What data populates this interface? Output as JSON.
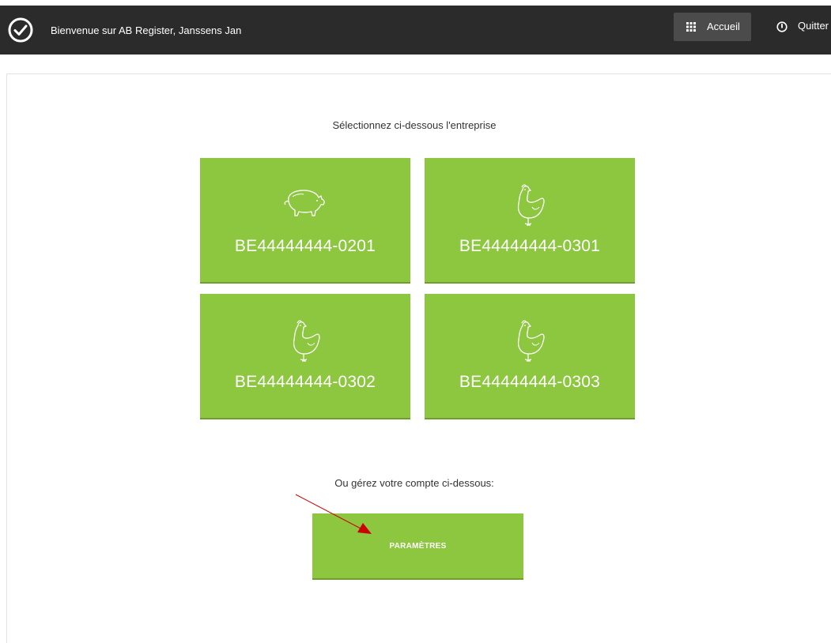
{
  "header": {
    "welcome": "Bienvenue sur AB Register, Janssens Jan",
    "home_label": "Accueil",
    "quit_label": "Quitter"
  },
  "main": {
    "heading": "Sélectionnez ci-dessous l'entreprise",
    "tiles": [
      {
        "code": "BE44444444-0201",
        "icon": "pig-icon"
      },
      {
        "code": "BE44444444-0301",
        "icon": "chicken-icon"
      },
      {
        "code": "BE44444444-0302",
        "icon": "chicken-icon"
      },
      {
        "code": "BE44444444-0303",
        "icon": "chicken-icon"
      }
    ],
    "account_heading": "Ou gérez votre compte ci-dessous:",
    "settings_label": "PARAMÈTRES"
  },
  "colors": {
    "topbar": "#2b2b2b",
    "tile_green": "#8dc63f",
    "annotation_arrow": "#cc0000"
  }
}
